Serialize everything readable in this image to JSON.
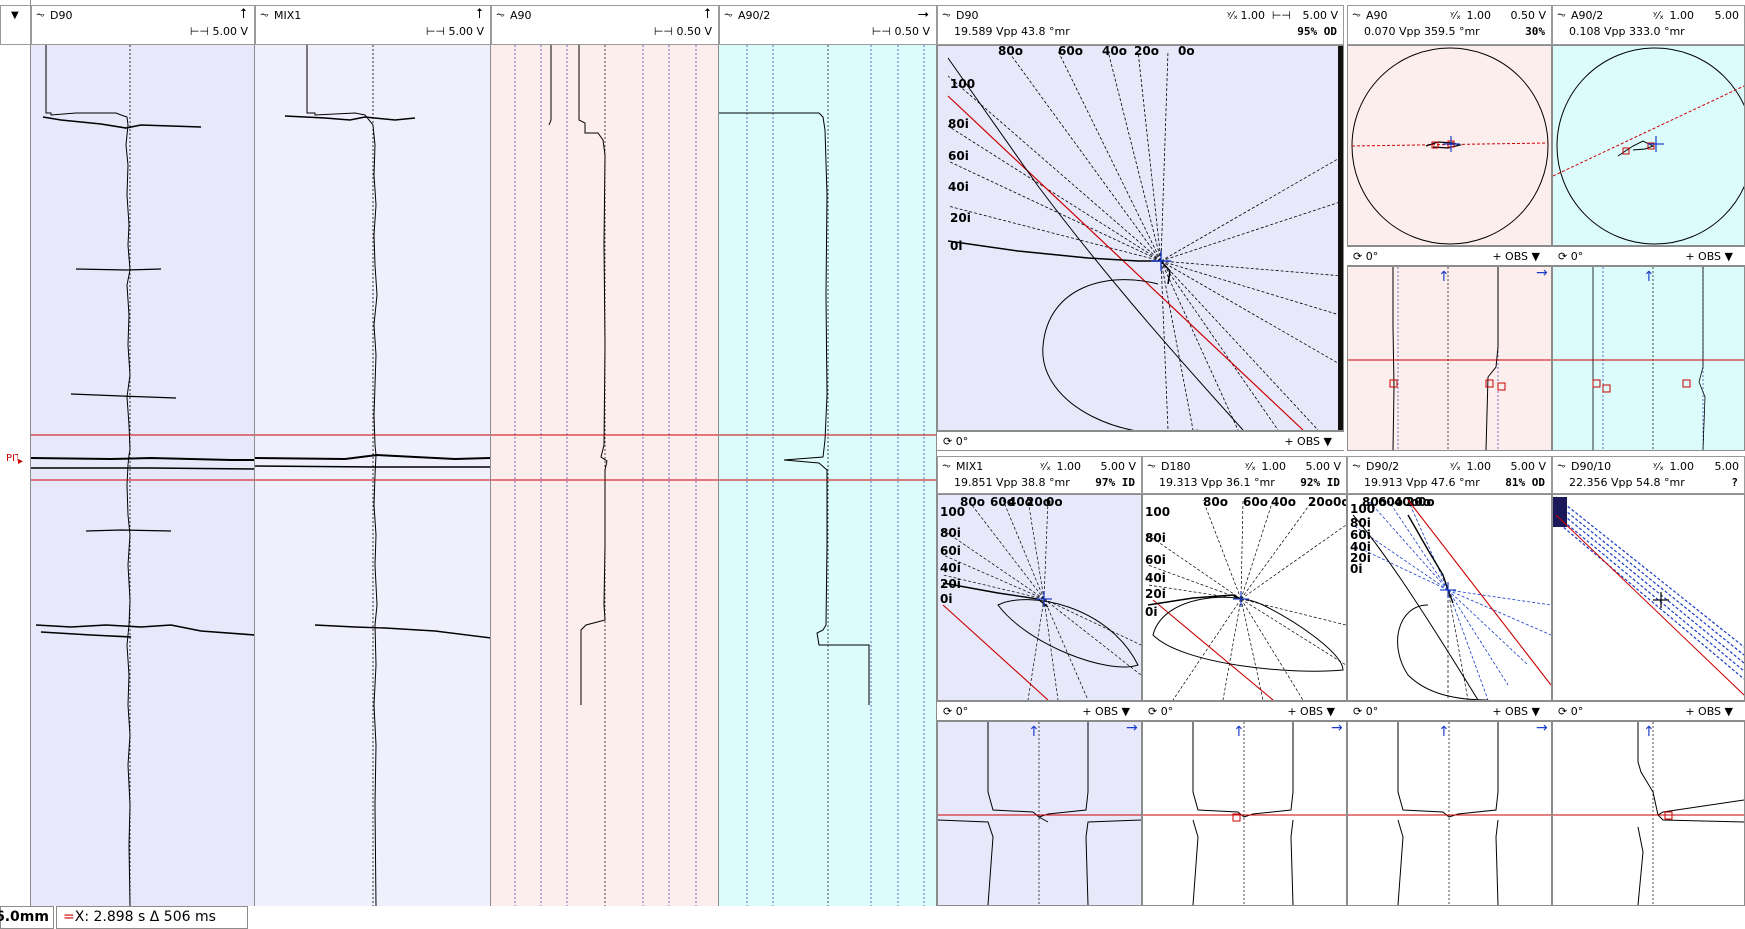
{
  "strip_channels": [
    {
      "name": "D90",
      "scale": "5.00 V",
      "icon": "up-arrow-icon"
    },
    {
      "name": "MIX1",
      "scale": "5.00 V",
      "icon": "up-arrow-icon"
    },
    {
      "name": "A90",
      "scale": "0.50 V",
      "icon": "up-arrow-icon"
    },
    {
      "name": "A90/2",
      "scale": "0.50 V",
      "icon": "right-arrow-icon"
    }
  ],
  "lissajous_top": [
    {
      "name": "D90",
      "gain": "1.00",
      "volt": "5.00 V",
      "vpp": "19.589 Vpp",
      "phase": "43.8 °mr",
      "result": "95% OD"
    },
    {
      "name": "A90",
      "gain": "1.00",
      "volt": "0.50 V",
      "vpp": "0.070 Vpp",
      "phase": "359.5 °mr",
      "result": "30%"
    },
    {
      "name": "A90/2",
      "gain": "1.00",
      "volt": "5.00",
      "vpp": "0.108 Vpp",
      "phase": "333.0 °mr",
      "result": ""
    }
  ],
  "lissajous_bottom": [
    {
      "name": "MIX1",
      "gain": "1.00",
      "volt": "5.00 V",
      "vpp": "19.851 Vpp",
      "phase": "38.8 °mr",
      "result": "97% ID"
    },
    {
      "name": "D180",
      "gain": "1.00",
      "volt": "5.00 V",
      "vpp": "19.313 Vpp",
      "phase": "36.1 °mr",
      "result": "92% ID"
    },
    {
      "name": "D90/2",
      "gain": "1.00",
      "volt": "5.00 V",
      "vpp": "19.913 Vpp",
      "phase": "47.6 °mr",
      "result": "81% OD"
    },
    {
      "name": "D90/10",
      "gain": "1.00",
      "volt": "5.00",
      "vpp": "22.356 Vpp",
      "phase": "54.8 °mr",
      "result": "?"
    }
  ],
  "d90_scale_labels": [
    "100",
    "80i",
    "60i",
    "40i",
    "20i",
    "0i",
    "80o",
    "60o",
    "40o",
    "20o",
    "0o"
  ],
  "mix1_scale_labels": [
    "100",
    "80i",
    "60i",
    "40i",
    "20i",
    "0i",
    "80o",
    "60o",
    "40o",
    "20o",
    "0o"
  ],
  "d180_scale_labels": [
    "100",
    "80i",
    "60i",
    "40i",
    "20i",
    "0i",
    "80o",
    "60o",
    "40o",
    "20o",
    "0o"
  ],
  "d90_2_scale_labels": [
    "100",
    "80i",
    "60i",
    "40i",
    "20i",
    "0i",
    "80o",
    "60o",
    "40o",
    "20o",
    "0o"
  ],
  "footer": {
    "rotation": "0°",
    "obs": "OBS"
  },
  "status": {
    "length": "6.0mm",
    "cursor": "X: 2.898 s Δ 506 ms"
  },
  "marker": "PIT",
  "colors": {
    "purple_bg": "#e8e8fb",
    "pink_bg": "#fdeeee",
    "cyan_bg": "#dcfbfb",
    "red": "#cc0000",
    "blue": "#1a3cc8"
  }
}
